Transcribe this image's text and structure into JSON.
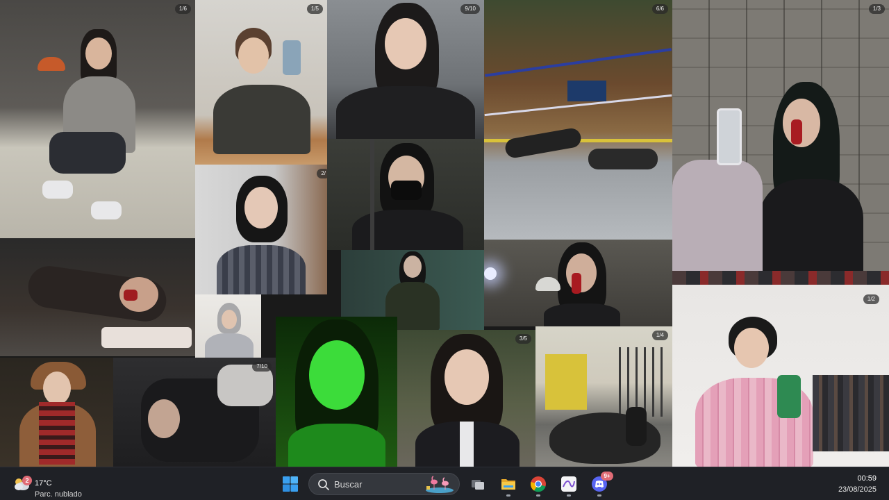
{
  "wallpaper": {
    "badges": [
      "1/6",
      "1/5",
      "9/10",
      "6/6",
      "1/3",
      "2/",
      "7/10",
      "3/5",
      "1/4",
      "1/2"
    ]
  },
  "taskbar": {
    "weather": {
      "notification_count": "2",
      "temperature": "17°C",
      "condition": "Parc. nublado"
    },
    "search": {
      "placeholder": "Buscar"
    },
    "apps": [
      {
        "name": "Vista de tareas",
        "icon": "task-view-icon"
      },
      {
        "name": "Explorador de archivos",
        "icon": "folder-icon"
      },
      {
        "name": "Google Chrome",
        "icon": "chrome-icon"
      },
      {
        "name": "Notas",
        "icon": "notes-app-icon"
      },
      {
        "name": "Discord",
        "icon": "discord-icon",
        "badge": "9+"
      }
    ],
    "clock": {
      "time": "00:59",
      "date": "23/08/2025"
    }
  },
  "colors": {
    "taskbar": "#1f2126",
    "accent_blue": "#3aa0f0",
    "badge_red": "#e06b75",
    "discord": "#5865f2"
  }
}
